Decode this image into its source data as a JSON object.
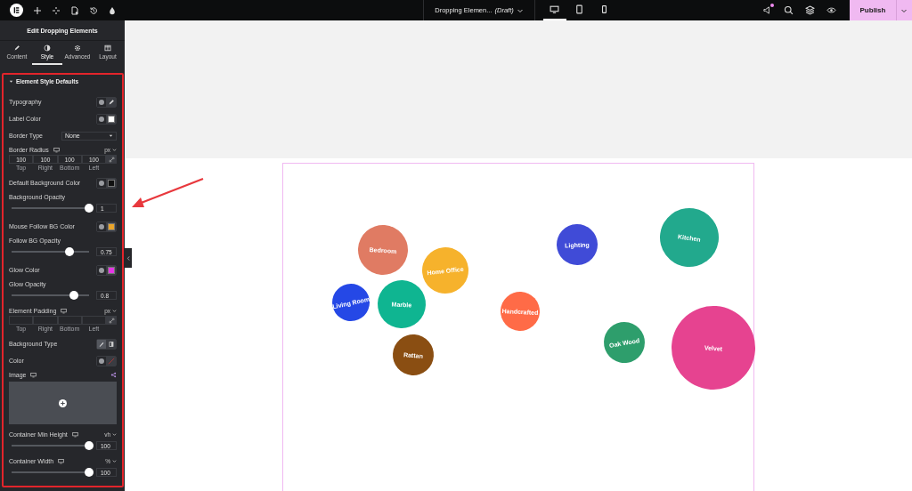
{
  "topbar": {
    "document_title": "Dropping Elemen...",
    "status": "(Draft)",
    "devices": [
      {
        "kind": "desktop",
        "selected": true
      },
      {
        "kind": "tablet",
        "selected": false
      },
      {
        "kind": "mobile",
        "selected": false
      }
    ],
    "notification": true,
    "publish": "Publish"
  },
  "panel": {
    "title": "Edit Dropping Elements",
    "tabs": [
      {
        "label": "Content",
        "kind": "content",
        "selected": false
      },
      {
        "label": "Style",
        "kind": "style",
        "selected": true
      },
      {
        "label": "Advanced",
        "kind": "advanced",
        "selected": false
      },
      {
        "label": "Layout",
        "kind": "layout",
        "selected": false
      }
    ],
    "section": {
      "label": "Element Style Defaults",
      "expanded": true
    },
    "controls": [
      {
        "kind": "typography",
        "label": "Typography"
      },
      {
        "kind": "color",
        "label": "Label Color",
        "color": "#ffffff"
      },
      {
        "kind": "select",
        "label": "Border Type",
        "value": "None"
      },
      {
        "kind": "dimensions",
        "label": "Border Radius",
        "unit": "px",
        "values": [
          "100",
          "100",
          "100",
          "100"
        ],
        "sides": [
          "Top",
          "Right",
          "Bottom",
          "Left"
        ]
      },
      {
        "kind": "color",
        "label": "Default Background Color",
        "color": "#111111"
      },
      {
        "kind": "slider",
        "label": "Background Opacity",
        "level": 1,
        "value": "1"
      },
      {
        "kind": "color",
        "label": "Mouse Follow BG Color",
        "color": "#eaa52a"
      },
      {
        "kind": "slider",
        "label": "Follow BG Opacity",
        "level": 0.75,
        "value": "0.75"
      },
      {
        "kind": "color",
        "label": "Glow Color",
        "color": "#e536e5"
      },
      {
        "kind": "slider",
        "label": "Glow Opacity",
        "level": 0.8,
        "value": "0.8"
      },
      {
        "kind": "dimensions",
        "label": "Element Padding",
        "unit": "px",
        "sides": [
          "Top",
          "Right",
          "Bottom",
          "Left"
        ]
      },
      {
        "kind": "choice",
        "label": "Background Type",
        "options": [
          {
            "kind": "classic",
            "selected": true
          },
          {
            "kind": "gradient",
            "selected": false
          }
        ]
      },
      {
        "kind": "color",
        "label": "Color"
      },
      {
        "kind": "image",
        "label": "Image"
      },
      {
        "kind": "slider",
        "label": "Container Min Height",
        "responsive": true,
        "unit": "vh",
        "level": 1,
        "value": "100"
      },
      {
        "kind": "slider",
        "label": "Container Width",
        "responsive": true,
        "unit": "%",
        "level": 1,
        "value": "100"
      }
    ]
  },
  "bubbles": [
    {
      "label": "Bedroom",
      "color": "#e07b63"
    },
    {
      "label": "Home Office",
      "color": "#f6b22c"
    },
    {
      "label": "Living Room",
      "color": "#2548e6"
    },
    {
      "label": "Marble",
      "color": "#0fb591"
    },
    {
      "label": "Rattan",
      "color": "#8a4e12"
    },
    {
      "label": "Handcrafted",
      "color": "#ff6b47"
    },
    {
      "label": "Lighting",
      "color": "#404bd7"
    },
    {
      "label": "Kitchen",
      "color": "#22a98d"
    },
    {
      "label": "Oak Wood",
      "color": "#2e9e6c"
    },
    {
      "label": "Velvet",
      "color": "#e64390"
    }
  ]
}
